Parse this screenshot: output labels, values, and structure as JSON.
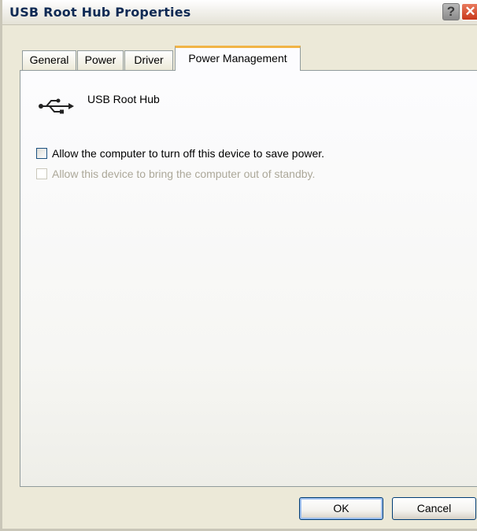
{
  "window": {
    "title": "USB Root Hub Properties",
    "help_glyph": "?",
    "close_glyph": "✕"
  },
  "tabs": [
    {
      "label": "General",
      "active": false
    },
    {
      "label": "Power",
      "active": false
    },
    {
      "label": "Driver",
      "active": false
    },
    {
      "label": "Power Management",
      "active": true
    }
  ],
  "device": {
    "icon": "usb-icon",
    "name": "USB Root Hub"
  },
  "options": [
    {
      "label": "Allow the computer to turn off this device to save power.",
      "checked": false,
      "enabled": true
    },
    {
      "label": "Allow this device to bring the computer out of standby.",
      "checked": false,
      "enabled": false
    }
  ],
  "buttons": {
    "ok": "OK",
    "cancel": "Cancel"
  },
  "colors": {
    "dialog_face": "#ECE9D8",
    "active_tab_accent": "#F1B446",
    "disabled_text": "#ACA899",
    "button_border": "#003C74"
  }
}
